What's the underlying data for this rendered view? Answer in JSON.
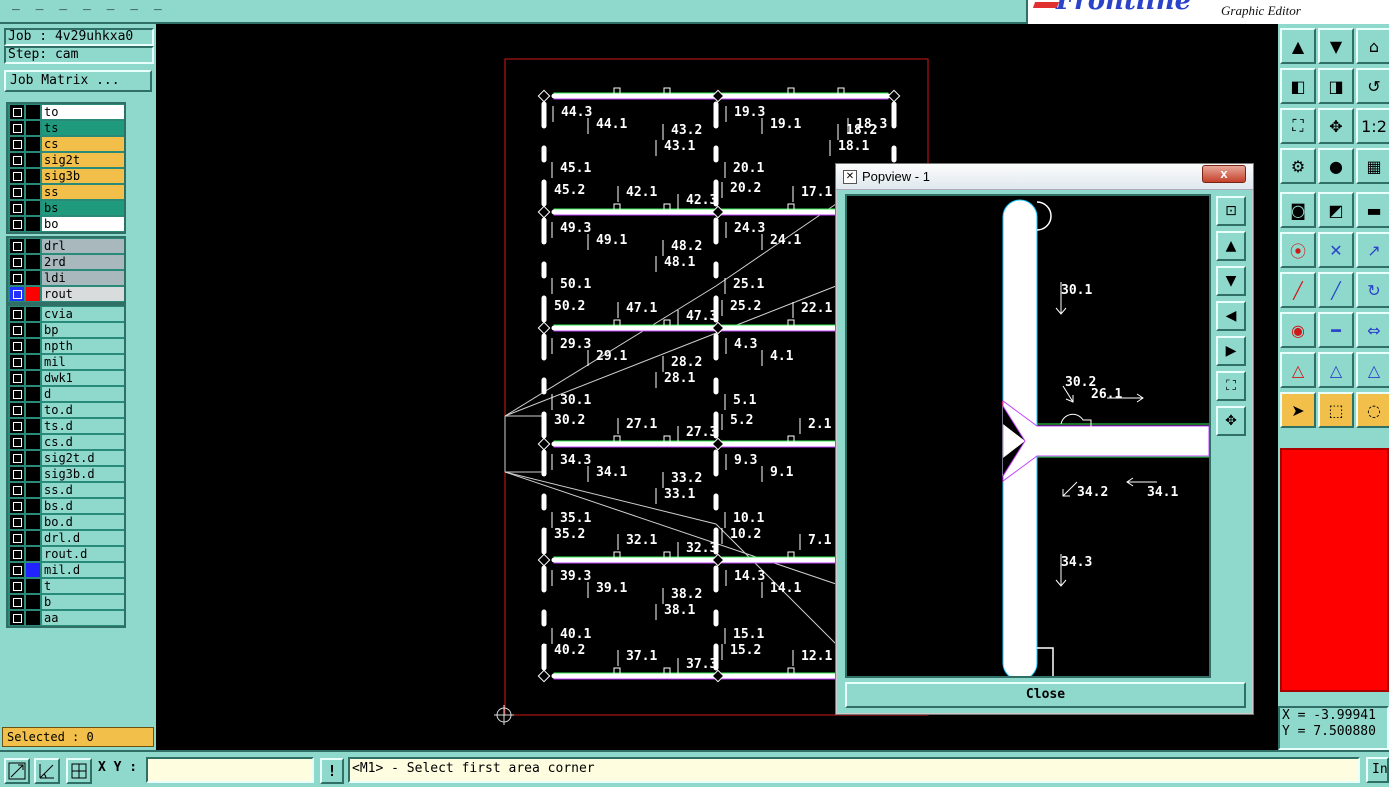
{
  "topbar": {
    "menu_fragment": "_  _   _   _   _ _ _",
    "brand_logo": "Frontline",
    "brand_subtitle": "Graphic Editor"
  },
  "left_panel": {
    "job": "Job : 4v29uhkxa0",
    "step": "Step: cam",
    "job_matrix_button": "Job Matrix ...",
    "board_layers": [
      {
        "name": "to",
        "color": "#ffffff"
      },
      {
        "name": "ts",
        "color": "#1f9a7c"
      },
      {
        "name": "cs",
        "color": "#f2c04a"
      },
      {
        "name": "sig2t",
        "color": "#f2c04a"
      },
      {
        "name": "sig3b",
        "color": "#f2c04a"
      },
      {
        "name": "ss",
        "color": "#f2c04a"
      },
      {
        "name": "bs",
        "color": "#1f9a7c"
      },
      {
        "name": "bo",
        "color": "#ffffff"
      }
    ],
    "drill_layers": [
      {
        "name": "drl",
        "color": "#a9b8bd"
      },
      {
        "name": "2rd",
        "color": "#a9b8bd"
      },
      {
        "name": "ldi",
        "color": "#a9b8bd"
      },
      {
        "name": "rout",
        "color": "#d8dcdc",
        "active": true,
        "swatch": "#ff0000"
      }
    ],
    "misc_layers": [
      {
        "name": "cvia"
      },
      {
        "name": "bp"
      },
      {
        "name": "npth"
      },
      {
        "name": "mil"
      },
      {
        "name": "dwk1"
      },
      {
        "name": "d"
      },
      {
        "name": "to.d"
      },
      {
        "name": "ts.d"
      },
      {
        "name": "cs.d"
      },
      {
        "name": "sig2t.d"
      },
      {
        "name": "sig3b.d"
      },
      {
        "name": "ss.d"
      },
      {
        "name": "bs.d"
      },
      {
        "name": "bo.d"
      },
      {
        "name": "drl.d"
      },
      {
        "name": "rout.d"
      },
      {
        "name": "mil.d",
        "swatch": "#2222ff"
      },
      {
        "name": "t"
      },
      {
        "name": "b"
      },
      {
        "name": "aa"
      }
    ],
    "misc_color": "#8fd8cc",
    "selected": "Selected : 0"
  },
  "bottombar": {
    "xy_label": "X Y :",
    "xy_value": "",
    "bang": "!",
    "status": "<M1> - Select first area corner",
    "right_button": "In"
  },
  "coords": {
    "x": "X = -3.99941",
    "y": "Y = 7.500880"
  },
  "popview": {
    "title": "Popview - 1",
    "close_x": "x",
    "close_button": "Close",
    "labels": [
      "30.1",
      "30.2",
      "26.1",
      "34.2",
      "34.1",
      "34.3"
    ]
  },
  "canvas": {
    "labels": [
      "44.3",
      "44.1",
      "43.1",
      "43.2",
      "19.3",
      "19.1",
      "18.1",
      "18.2",
      "18.3",
      "45.1",
      "45.2",
      "42.1",
      "42.3",
      "20.1",
      "20.2",
      "17.1",
      "49.3",
      "49.1",
      "48.1",
      "48.2",
      "24.3",
      "24.1",
      "50.1",
      "50.2",
      "47.1",
      "47.3",
      "25.1",
      "25.2",
      "22.1",
      "29.3",
      "29.1",
      "28.1",
      "28.2",
      "4.3",
      "4.1",
      "30.1",
      "30.2",
      "27.1",
      "27.3",
      "5.1",
      "5.2",
      "2.1",
      "34.3",
      "34.1",
      "33.1",
      "33.2",
      "9.3",
      "9.1",
      "35.1",
      "35.2",
      "32.1",
      "32.3",
      "10.1",
      "10.2",
      "7.1",
      "39.3",
      "39.1",
      "38.1",
      "38.2",
      "14.3",
      "14.1",
      "40.1",
      "40.2",
      "37.1",
      "37.3",
      "15.1",
      "15.2",
      "12.1"
    ]
  }
}
